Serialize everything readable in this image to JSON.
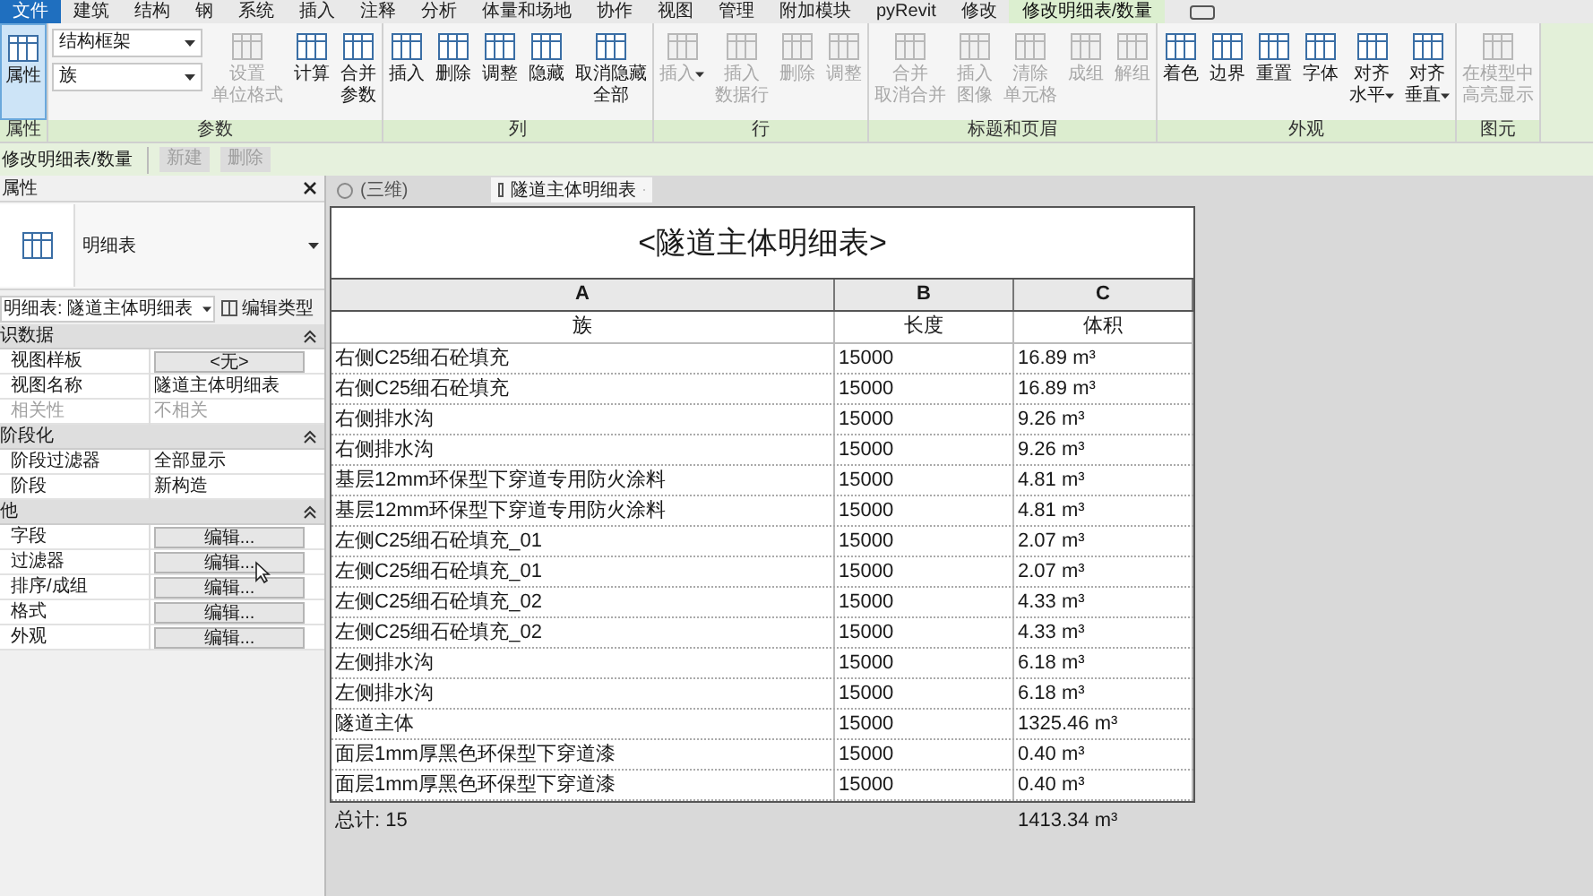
{
  "menu_tabs": [
    {
      "label": "文件",
      "selected": false,
      "kind": "file"
    },
    {
      "label": "建筑",
      "selected": false,
      "kind": "tab"
    },
    {
      "label": "结构",
      "selected": false,
      "kind": "tab"
    },
    {
      "label": "钢",
      "selected": false,
      "kind": "tab"
    },
    {
      "label": "系统",
      "selected": false,
      "kind": "tab"
    },
    {
      "label": "插入",
      "selected": false,
      "kind": "tab"
    },
    {
      "label": "注释",
      "selected": false,
      "kind": "tab"
    },
    {
      "label": "分析",
      "selected": false,
      "kind": "tab"
    },
    {
      "label": "体量和场地",
      "selected": false,
      "kind": "tab"
    },
    {
      "label": "协作",
      "selected": false,
      "kind": "tab"
    },
    {
      "label": "视图",
      "selected": false,
      "kind": "tab"
    },
    {
      "label": "管理",
      "selected": false,
      "kind": "tab"
    },
    {
      "label": "附加模块",
      "selected": false,
      "kind": "tab"
    },
    {
      "label": "pyRevit",
      "selected": false,
      "kind": "tab"
    },
    {
      "label": "修改",
      "selected": false,
      "kind": "tab"
    },
    {
      "label": "修改明细表/数量",
      "selected": true,
      "kind": "tab"
    }
  ],
  "ribbon_groups": [
    {
      "label": "属性",
      "tools": [
        {
          "kind": "toggle",
          "lines": [
            "属性"
          ],
          "on": true
        }
      ]
    },
    {
      "label": "参数",
      "tools": [
        {
          "kind": "combos",
          "combos": [
            "结构框架",
            "族"
          ]
        },
        {
          "kind": "button",
          "lines": [
            "设置",
            "单位格式"
          ],
          "disabled": true,
          "dropdown": false
        },
        {
          "kind": "button",
          "lines": [
            "计算"
          ],
          "disabled": false,
          "dropdown": false
        },
        {
          "kind": "button",
          "lines": [
            "合并",
            "参数"
          ],
          "disabled": false,
          "dropdown": false
        }
      ]
    },
    {
      "label": "列",
      "tools": [
        {
          "kind": "button",
          "lines": [
            "插入"
          ],
          "disabled": false,
          "dropdown": false
        },
        {
          "kind": "button",
          "lines": [
            "删除"
          ],
          "disabled": false,
          "dropdown": false
        },
        {
          "kind": "button",
          "lines": [
            "调整"
          ],
          "disabled": false,
          "dropdown": false
        },
        {
          "kind": "button",
          "lines": [
            "隐藏"
          ],
          "disabled": false,
          "dropdown": false
        },
        {
          "kind": "button",
          "lines": [
            "取消隐藏",
            "全部"
          ],
          "disabled": false,
          "dropdown": false
        }
      ]
    },
    {
      "label": "行",
      "tools": [
        {
          "kind": "button",
          "lines": [
            "插入"
          ],
          "disabled": true,
          "dropdown": true
        },
        {
          "kind": "button",
          "lines": [
            "插入",
            "数据行"
          ],
          "disabled": true,
          "dropdown": false
        },
        {
          "kind": "button",
          "lines": [
            "删除"
          ],
          "disabled": true,
          "dropdown": false
        },
        {
          "kind": "button",
          "lines": [
            "调整"
          ],
          "disabled": true,
          "dropdown": false
        }
      ]
    },
    {
      "label": "标题和页眉",
      "tools": [
        {
          "kind": "button",
          "lines": [
            "合并",
            "取消合并"
          ],
          "disabled": true,
          "dropdown": false
        },
        {
          "kind": "button",
          "lines": [
            "插入",
            "图像"
          ],
          "disabled": true,
          "dropdown": false
        },
        {
          "kind": "button",
          "lines": [
            "清除",
            "单元格"
          ],
          "disabled": true,
          "dropdown": false
        },
        {
          "kind": "button",
          "lines": [
            "成组"
          ],
          "disabled": true,
          "dropdown": false
        },
        {
          "kind": "button",
          "lines": [
            "解组"
          ],
          "disabled": true,
          "dropdown": false
        }
      ]
    },
    {
      "label": "外观",
      "tools": [
        {
          "kind": "button",
          "lines": [
            "着色"
          ],
          "disabled": false,
          "dropdown": false
        },
        {
          "kind": "button",
          "lines": [
            "边界"
          ],
          "disabled": false,
          "dropdown": false
        },
        {
          "kind": "button",
          "lines": [
            "重置"
          ],
          "disabled": false,
          "dropdown": false
        },
        {
          "kind": "button",
          "lines": [
            "字体"
          ],
          "disabled": false,
          "dropdown": false
        },
        {
          "kind": "button",
          "lines": [
            "对齐",
            "水平"
          ],
          "disabled": false,
          "dropdown": true
        },
        {
          "kind": "button",
          "lines": [
            "对齐",
            "垂直"
          ],
          "disabled": false,
          "dropdown": true
        }
      ]
    },
    {
      "label": "图元",
      "tools": [
        {
          "kind": "button",
          "lines": [
            "在模型中",
            "高亮显示"
          ],
          "disabled": true,
          "dropdown": false
        }
      ]
    }
  ],
  "context_bar": {
    "title": "修改明细表/数量",
    "buttons": [
      {
        "label": "新建",
        "disabled": true
      },
      {
        "label": "删除",
        "disabled": true
      }
    ]
  },
  "properties": {
    "title": "属性",
    "type_name": "明细表",
    "instance": "明细表: 隧道主体明细表",
    "edit_type": "编辑类型",
    "sections": [
      {
        "title": "识数据",
        "expanded": true,
        "rows": [
          {
            "label": "视图样板",
            "value": "<无>",
            "kind": "button",
            "disabled": false
          },
          {
            "label": "视图名称",
            "value": "隧道主体明细表",
            "kind": "text",
            "disabled": false
          },
          {
            "label": "相关性",
            "value": "不相关",
            "kind": "text",
            "disabled": true
          }
        ]
      },
      {
        "title": "阶段化",
        "expanded": true,
        "rows": [
          {
            "label": "阶段过滤器",
            "value": "全部显示",
            "kind": "text",
            "disabled": false
          },
          {
            "label": "阶段",
            "value": "新构造",
            "kind": "text",
            "disabled": false
          }
        ]
      },
      {
        "title": "他",
        "expanded": true,
        "rows": [
          {
            "label": "字段",
            "value": "编辑...",
            "kind": "button",
            "disabled": false
          },
          {
            "label": "过滤器",
            "value": "编辑...",
            "kind": "button",
            "disabled": false
          },
          {
            "label": "排序/成组",
            "value": "编辑...",
            "kind": "button",
            "disabled": false
          },
          {
            "label": "格式",
            "value": "编辑...",
            "kind": "button",
            "disabled": false
          },
          {
            "label": "外观",
            "value": "编辑...",
            "kind": "button",
            "disabled": false
          }
        ]
      }
    ]
  },
  "doc_tabs": [
    {
      "label": "(三维)",
      "selected": false,
      "kind": "model"
    },
    {
      "label": "隧道主体明细表",
      "selected": true,
      "kind": "schedule"
    }
  ],
  "schedule": {
    "title": "<隧道主体明细表>",
    "column_letters": [
      "A",
      "B",
      "C"
    ],
    "headers": [
      "族",
      "长度",
      "体积"
    ],
    "rows": [
      [
        "右侧C25细石砼填充",
        "15000",
        "16.89 m³"
      ],
      [
        "右侧C25细石砼填充",
        "15000",
        "16.89 m³"
      ],
      [
        "右侧排水沟",
        "15000",
        "9.26 m³"
      ],
      [
        "右侧排水沟",
        "15000",
        "9.26 m³"
      ],
      [
        "基层12mm环保型下穿道专用防火涂料",
        "15000",
        "4.81 m³"
      ],
      [
        "基层12mm环保型下穿道专用防火涂料",
        "15000",
        "4.81 m³"
      ],
      [
        "左侧C25细石砼填充_01",
        "15000",
        "2.07 m³"
      ],
      [
        "左侧C25细石砼填充_01",
        "15000",
        "2.07 m³"
      ],
      [
        "左侧C25细石砼填充_02",
        "15000",
        "4.33 m³"
      ],
      [
        "左侧C25细石砼填充_02",
        "15000",
        "4.33 m³"
      ],
      [
        "左侧排水沟",
        "15000",
        "6.18 m³"
      ],
      [
        "左侧排水沟",
        "15000",
        "6.18 m³"
      ],
      [
        "隧道主体",
        "15000",
        "1325.46 m³"
      ],
      [
        "面层1mm厚黑色环保型下穿道漆",
        "15000",
        "0.40 m³"
      ],
      [
        "面层1mm厚黑色环保型下穿道漆",
        "15000",
        "0.40 m³"
      ]
    ],
    "total_label": "总计: 15",
    "total_volume": "1413.34 m³"
  }
}
